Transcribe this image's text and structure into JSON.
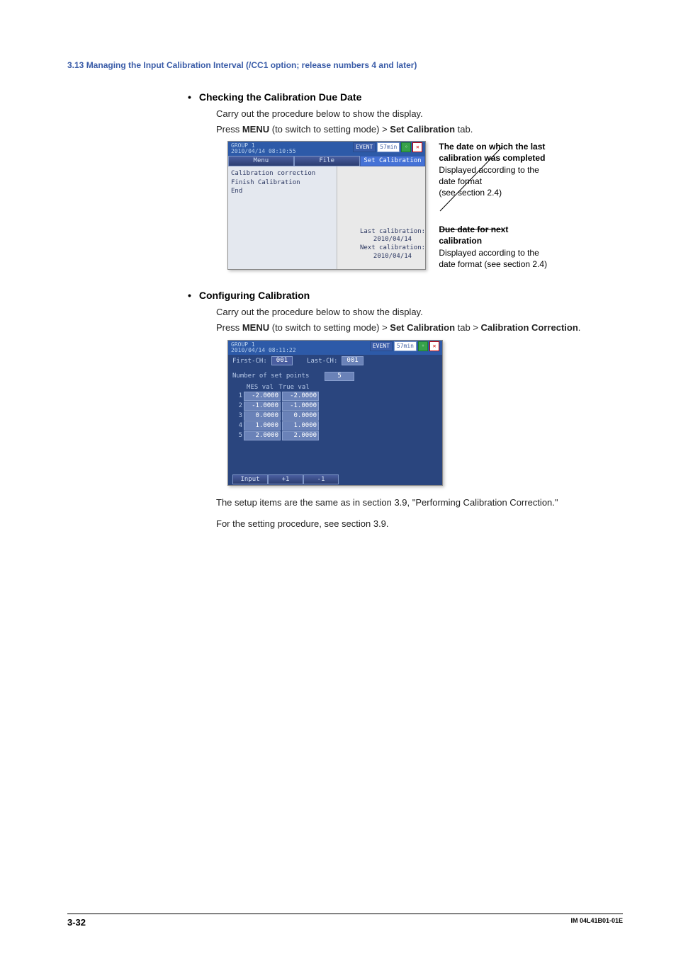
{
  "header": {
    "section": "3.13  Managing the Input Calibration Interval (/CC1 option; release numbers 4 and later)"
  },
  "checking": {
    "bullet": "•",
    "title": "Checking the Calibration Due Date",
    "line1": "Carry out the procedure below to show the display.",
    "line2_pre": "Press ",
    "line2_menu": "MENU",
    "line2_mid": " (to switch to setting mode) > ",
    "line2_tab": "Set Calibration",
    "line2_post": " tab."
  },
  "ss1": {
    "group": "GROUP 1",
    "timestamp": "2010/04/14 08:10:55",
    "evt": "EVENT",
    "rate": "57min",
    "tabs": {
      "menu": "Menu",
      "file": "File",
      "setcal": "Set Calibration"
    },
    "menu": {
      "item1": "Calibration correction",
      "item2": "Finish Calibration",
      "item3": "End"
    },
    "info": {
      "last_label": "Last calibration:",
      "last_date": "2010/04/14",
      "next_label": "Next calibration:",
      "next_date": "2010/04/14"
    }
  },
  "anno": {
    "a1_t1": "The date on which the last",
    "a1_t2": "calibration was completed",
    "a1_d1": "Displayed according to the",
    "a1_d2": "date format",
    "a1_d3": "(see section 2.4)",
    "a2_t1": "Due date for next",
    "a2_t2": "calibration",
    "a2_d1": "Displayed according to the",
    "a2_d2": "date format (see section 2.4)"
  },
  "configuring": {
    "bullet": "•",
    "title": "Configuring Calibration",
    "line1": "Carry out the procedure below to show the display.",
    "line2_pre": "Press ",
    "line2_menu": "MENU",
    "line2_mid": " (to switch to setting mode) > ",
    "line2_tab": "Set Calibration",
    "line2_mid2": " tab > ",
    "line2_cc": "Calibration Correction",
    "line2_post": "."
  },
  "ss2": {
    "group": "GROUP 1",
    "timestamp": "2010/04/14 08:11:22",
    "evt": "EVENT",
    "rate": "57min",
    "first_lbl": "First-CH:",
    "first_val": "001",
    "last_lbl": "Last-CH:",
    "last_val": "001",
    "nsp_lbl": "Number of set points",
    "nsp_val": "5",
    "col1": "MES val",
    "col2": "True val",
    "rows": [
      {
        "i": "1",
        "a": "-2.0000",
        "b": "-2.0000"
      },
      {
        "i": "2",
        "a": "-1.0000",
        "b": "-1.0000"
      },
      {
        "i": "3",
        "a": "0.0000",
        "b": "0.0000"
      },
      {
        "i": "4",
        "a": "1.0000",
        "b": "1.0000"
      },
      {
        "i": "5",
        "a": "2.0000",
        "b": "2.0000"
      }
    ],
    "btn_input": "Input",
    "btn_plus": "+1",
    "btn_minus": "-1"
  },
  "after": {
    "p1": "The setup items are the same as in section 3.9, \"Performing Calibration Correction.\"",
    "p2": "For the setting procedure, see section 3.9."
  },
  "footer": {
    "page": "3-32",
    "docid": "IM 04L41B01-01E"
  }
}
